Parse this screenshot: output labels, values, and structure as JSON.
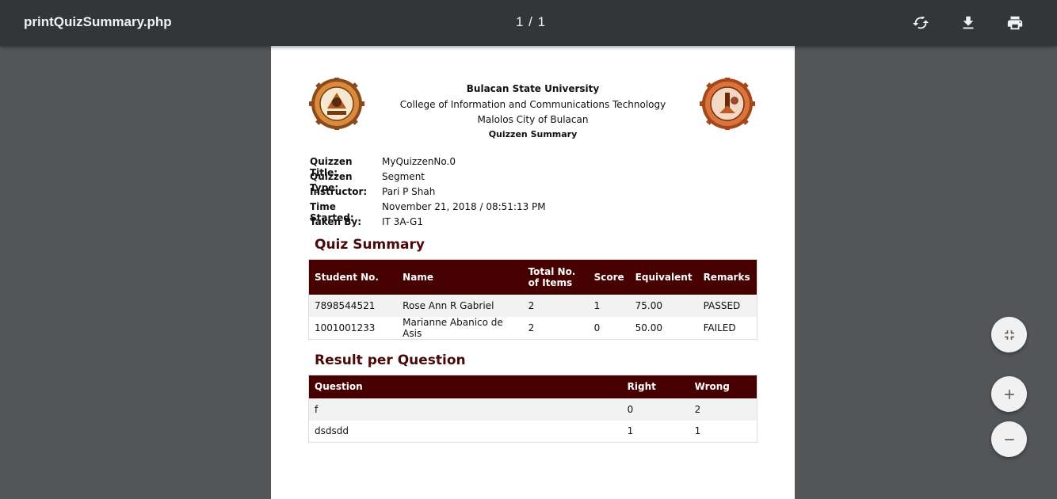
{
  "toolbar": {
    "title": "printQuizSummary.php",
    "page_counter": "1 / 1",
    "icons": [
      "rotate-icon",
      "download-icon",
      "print-icon"
    ]
  },
  "header": {
    "university": "Bulacan State University",
    "college": "College of Information and Communications Technology",
    "city": "Malolos City of Bulacan",
    "subtitle": "Quizzen Summary"
  },
  "meta": [
    {
      "key": "Quizzen Title:",
      "value": "MyQuizzenNo.0"
    },
    {
      "key": "Quizzen Type:",
      "value": "Segment"
    },
    {
      "key": "Instructor:",
      "value": "Pari P Shah"
    },
    {
      "key": "Time Started:",
      "value": "November 21, 2018 / 08:51:13 PM"
    },
    {
      "key": "Taken By:",
      "value": "IT 3A-G1"
    }
  ],
  "quiz_summary": {
    "title": "Quiz Summary",
    "columns": [
      "Student No.",
      "Name",
      "Total No. of Items",
      "Score",
      "Equivalent",
      "Remarks"
    ],
    "rows": [
      [
        "7898544521",
        "Rose Ann R Gabriel",
        "2",
        "1",
        "75.00",
        "PASSED"
      ],
      [
        "1001001233",
        "Marianne Abanico de Asis",
        "2",
        "0",
        "50.00",
        "FAILED"
      ]
    ]
  },
  "result_per_question": {
    "title": "Result per Question",
    "columns": [
      "Question",
      "Right",
      "Wrong"
    ],
    "rows": [
      [
        "f",
        "0",
        "2"
      ],
      [
        "dsdsdd",
        "1",
        "1"
      ]
    ]
  },
  "colors": {
    "toolbar_bg": "#323639",
    "viewer_bg": "#525659",
    "table_header_bg": "#470000",
    "section_title": "#4a0808"
  },
  "side_controls": [
    "fit-page-icon",
    "zoom-in-icon",
    "zoom-out-icon"
  ]
}
